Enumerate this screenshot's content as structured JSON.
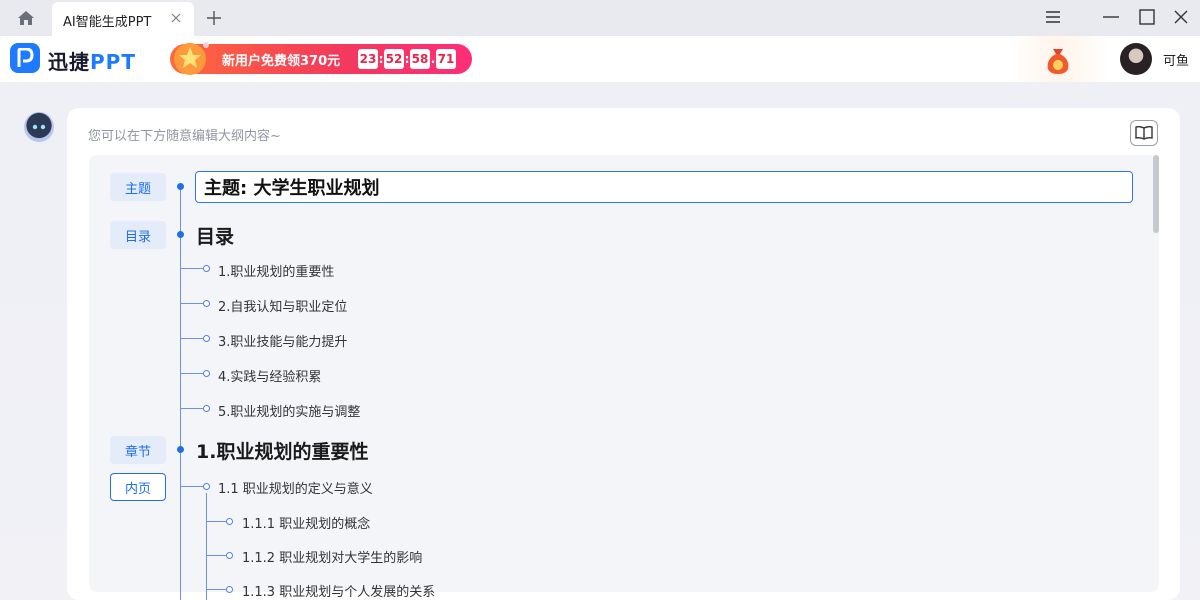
{
  "tab": {
    "title": "AI智能生成PPT"
  },
  "app": {
    "logo_text": "迅捷",
    "logo_ppt": "PPT",
    "promo_text": "新用户免费领370元",
    "countdown": [
      "23",
      "52",
      "58",
      "71"
    ],
    "username": "可鱼"
  },
  "editor": {
    "hint": "您可以在下方随意编辑大纲内容~",
    "topic_value": "主题: 大学生职业规划",
    "toc_heading": "目录",
    "toc_items": [
      "1.职业规划的重要性",
      "2.自我认知与职业定位",
      "3.职业技能与能力提升",
      "4.实践与经验积累",
      "5.职业规划的实施与调整"
    ],
    "chapter_heading": "1.职业规划的重要性",
    "page_heading": "1.1 职业规划的定义与意义",
    "sub_items": [
      "1.1.1 职业规划的概念",
      "1.1.2 职业规划对大学生的影响",
      "1.1.3 职业规划与个人发展的关系"
    ]
  },
  "tags": {
    "topic": "主题",
    "toc": "目录",
    "chapter": "章节",
    "page": "内页"
  },
  "colors": {
    "accent": "#1e6fe8",
    "promo": "#f33a5c",
    "background": "#f3f4f8"
  },
  "icons": [
    "home-icon",
    "close-icon",
    "plus-icon",
    "menu-icon",
    "minimize-icon",
    "maximize-icon",
    "close-window-icon",
    "reward-icon",
    "robot-icon",
    "book-icon"
  ]
}
